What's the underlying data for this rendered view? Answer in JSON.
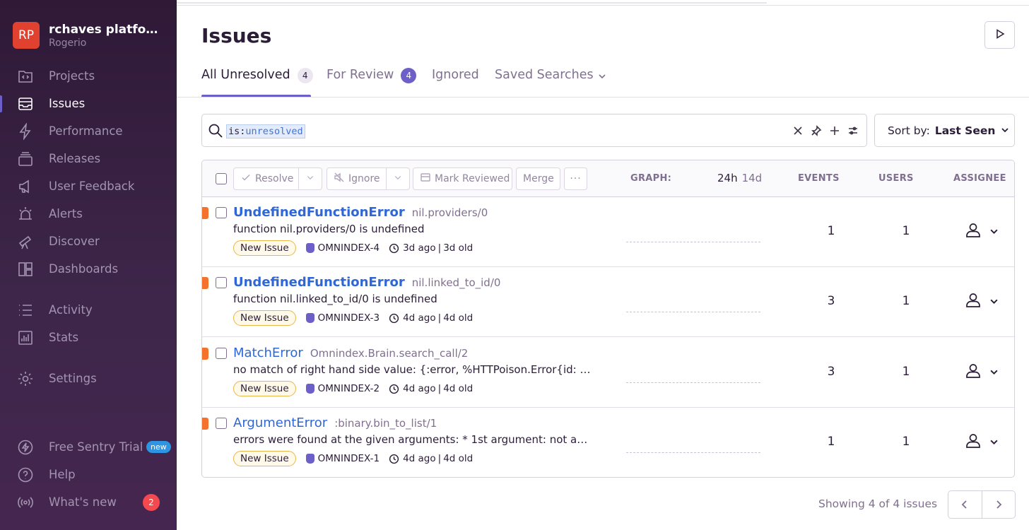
{
  "org": {
    "initials": "RP",
    "name": "rchaves platfor…",
    "user": "Rogerio"
  },
  "nav": {
    "projects": "Projects",
    "issues": "Issues",
    "performance": "Performance",
    "releases": "Releases",
    "user_feedback": "User Feedback",
    "alerts": "Alerts",
    "discover": "Discover",
    "dashboards": "Dashboards",
    "activity": "Activity",
    "stats": "Stats",
    "settings": "Settings",
    "free_trial": "Free Sentry Trial",
    "free_trial_badge": "new",
    "help": "Help",
    "whats_new": "What's new",
    "whats_new_count": "2"
  },
  "page": {
    "title": "Issues"
  },
  "tabs": {
    "all_unresolved": "All Unresolved",
    "all_unresolved_count": "4",
    "for_review": "For Review",
    "for_review_count": "4",
    "ignored": "Ignored",
    "saved_searches": "Saved Searches"
  },
  "search": {
    "key": "is:",
    "value": "unresolved"
  },
  "sort": {
    "label": "Sort by:",
    "value": "Last Seen"
  },
  "toolbar": {
    "resolve": "Resolve",
    "ignore": "Ignore",
    "mark_reviewed": "Mark Reviewed",
    "merge": "Merge",
    "more": "···",
    "graph": "GRAPH:",
    "period_24h": "24h",
    "period_14d": "14d",
    "events": "EVENTS",
    "users": "USERS",
    "assignee": "ASSIGNEE"
  },
  "issues": [
    {
      "type": "UndefinedFunctionError",
      "location": "nil.providers/0",
      "message": "function nil.providers/0 is undefined",
      "status": "New Issue",
      "project": "OMNINDEX-4",
      "last_seen": "3d ago",
      "age": "3d old",
      "events": "1",
      "users": "1"
    },
    {
      "type": "UndefinedFunctionError",
      "location": "nil.linked_to_id/0",
      "message": "function nil.linked_to_id/0 is undefined",
      "status": "New Issue",
      "project": "OMNINDEX-3",
      "last_seen": "4d ago",
      "age": "4d old",
      "events": "3",
      "users": "1"
    },
    {
      "type": "MatchError",
      "location": "Omnindex.Brain.search_call/2",
      "message": "no match of right hand side value: {:error, %HTTPoison.Error{id: …",
      "status": "New Issue",
      "project": "OMNINDEX-2",
      "last_seen": "4d ago",
      "age": "4d old",
      "events": "3",
      "users": "1"
    },
    {
      "type": "ArgumentError",
      "location": ":binary.bin_to_list/1",
      "message": "errors were found at the given arguments: * 1st argument: not a…",
      "status": "New Issue",
      "project": "OMNINDEX-1",
      "last_seen": "4d ago",
      "age": "4d old",
      "events": "1",
      "users": "1"
    }
  ],
  "footer": {
    "showing": "Showing 4 of 4 issues"
  },
  "colors": {
    "accent": "#6c5fc7",
    "link": "#2f67d6",
    "level_error": "#f4722b",
    "sidebar_bg": "#2f1937"
  }
}
